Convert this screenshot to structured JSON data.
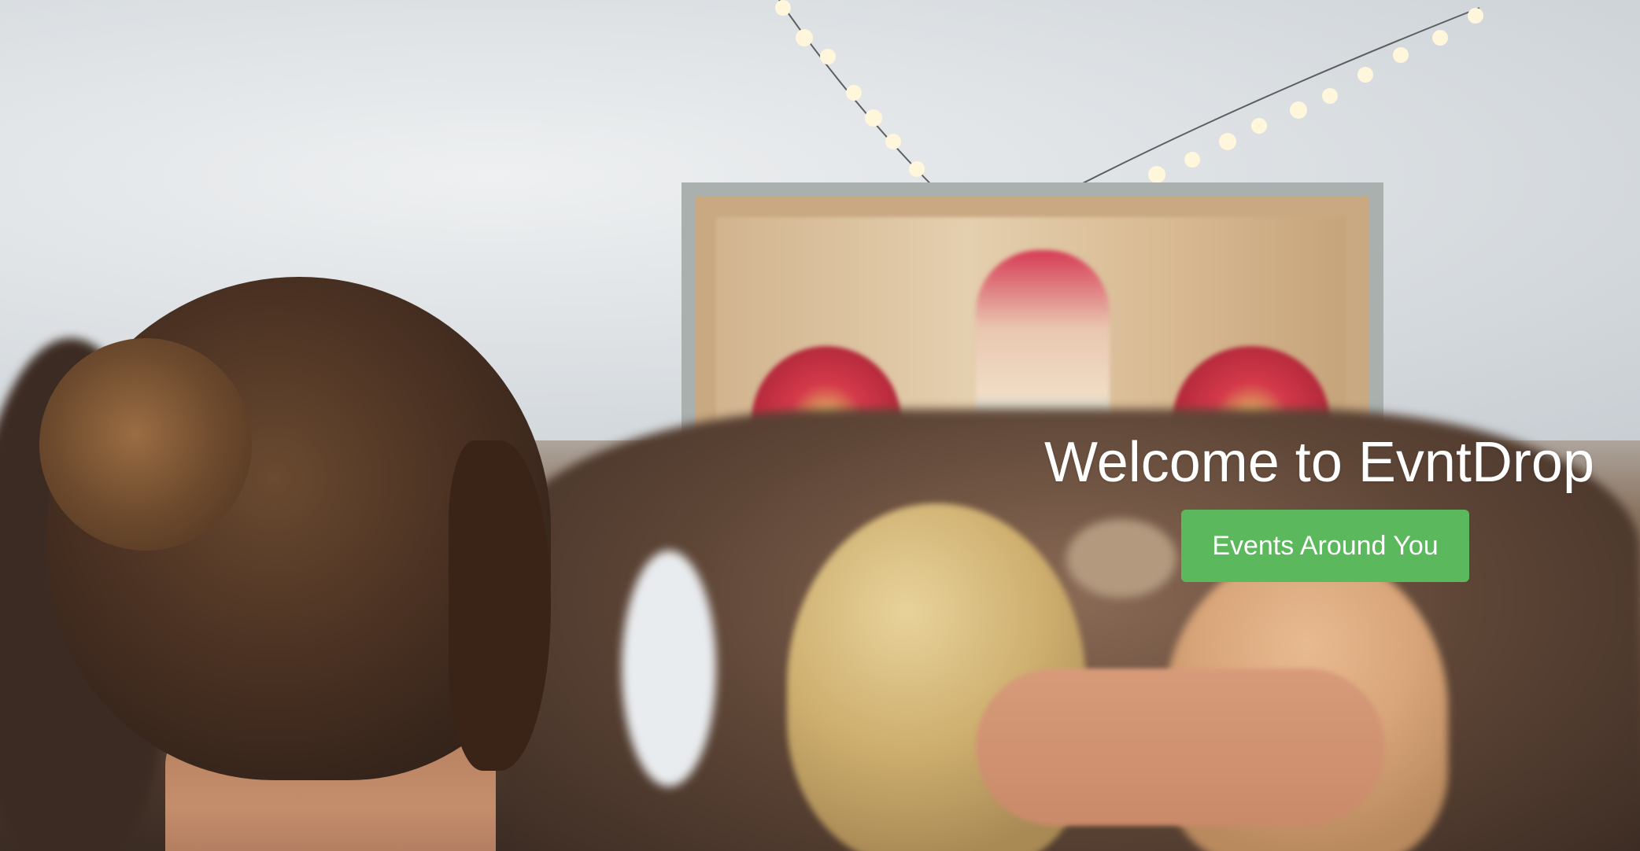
{
  "hero": {
    "title": "Welcome to EvntDrop",
    "cta_label": "Events Around You",
    "background_description": "festival crowd in front of an outdoor stage with string lights"
  },
  "colors": {
    "cta_background": "#5cb85c",
    "title_text": "#ffffff"
  }
}
